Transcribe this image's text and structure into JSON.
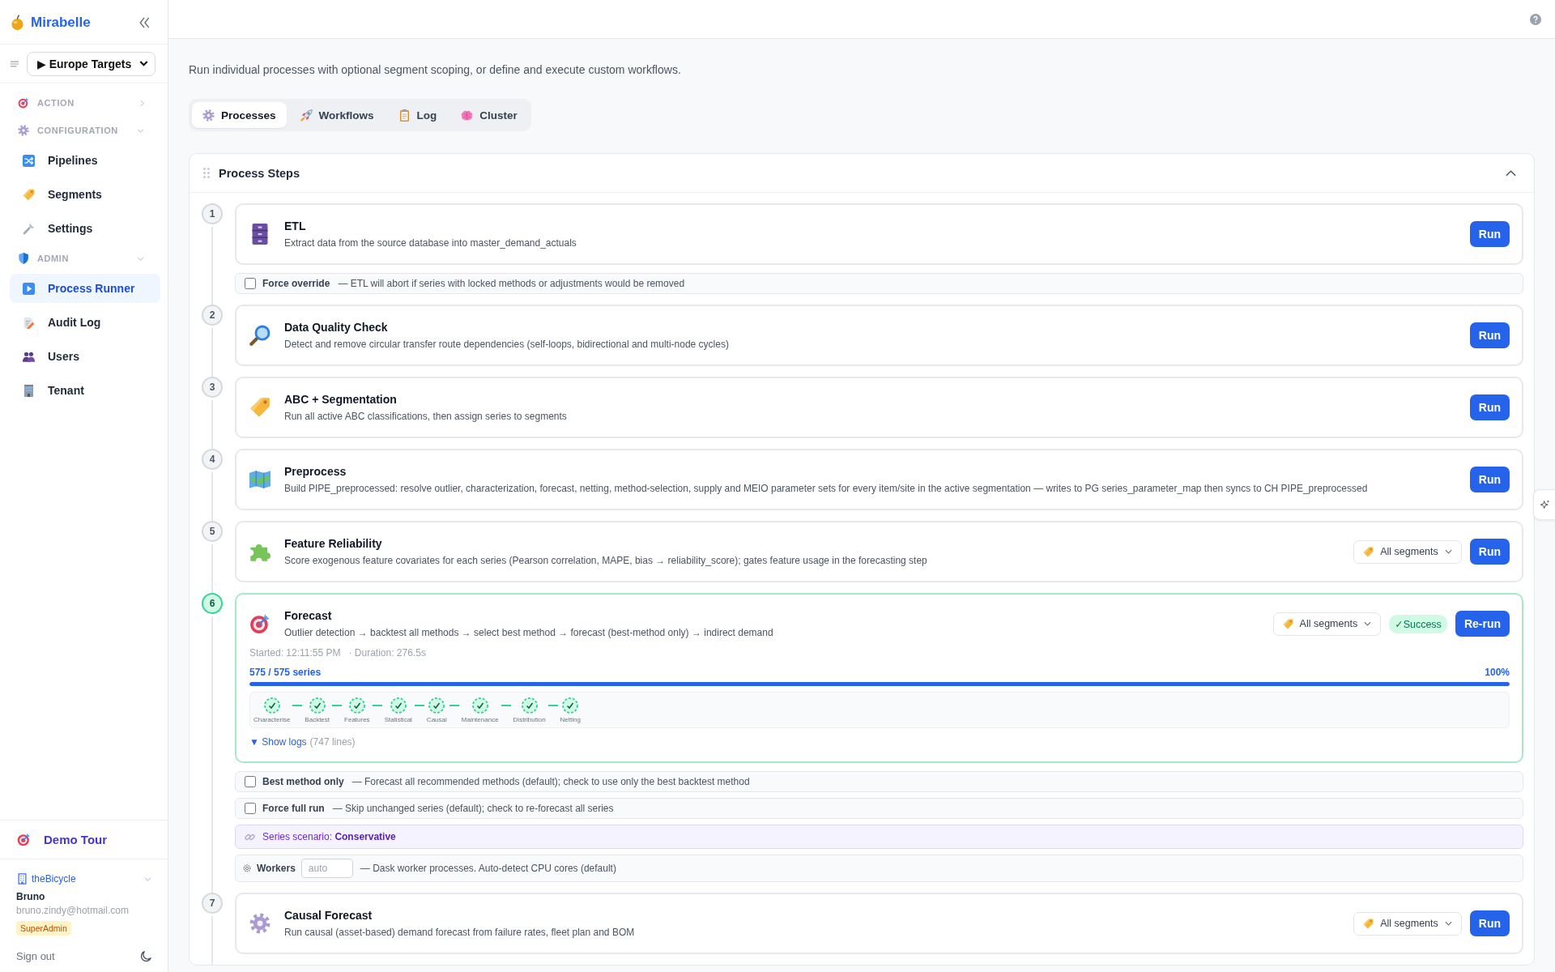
{
  "sidebar": {
    "brand": "Mirabelle",
    "selector": {
      "value": "▶ Europe Targets"
    },
    "sections": [
      {
        "label": "ACTION",
        "expanded": false
      },
      {
        "label": "CONFIGURATION",
        "expanded": true,
        "items": [
          {
            "label": "Pipelines",
            "selected": false
          },
          {
            "label": "Segments",
            "selected": false
          },
          {
            "label": "Settings",
            "selected": false
          }
        ]
      },
      {
        "label": "ADMIN",
        "expanded": true,
        "items": [
          {
            "label": "Process Runner",
            "selected": true
          },
          {
            "label": "Audit Log",
            "selected": false
          },
          {
            "label": "Users",
            "selected": false
          },
          {
            "label": "Tenant",
            "selected": false
          }
        ]
      }
    ],
    "demo_tour": "Demo Tour",
    "tenant": "theBicycle",
    "user": {
      "name": "Bruno",
      "email": "bruno.zindy@hotmail.com",
      "role": "SuperAdmin"
    },
    "sign_out": "Sign out"
  },
  "description": "Run individual processes with optional segment scoping, or define and execute custom workflows.",
  "tabs": [
    {
      "label": "Processes",
      "selected": true
    },
    {
      "label": "Workflows",
      "selected": false
    },
    {
      "label": "Log",
      "selected": false
    },
    {
      "label": "Cluster",
      "selected": false
    }
  ],
  "panel": {
    "title": "Process Steps",
    "expanded": true,
    "steps": [
      {
        "number": "1",
        "title": "ETL",
        "description": "Extract data from the source database into master_demand_actuals",
        "succeeded": false,
        "button": "Run",
        "options": [
          {
            "kind": "checkbox",
            "label": "Force override",
            "checked": false,
            "note": "— ETL will abort if series with locked methods or adjustments would be removed"
          }
        ]
      },
      {
        "number": "2",
        "title": "Data Quality Check",
        "description": "Detect and remove circular transfer route dependencies (self-loops, bidirectional and multi-node cycles)",
        "succeeded": false,
        "button": "Run"
      },
      {
        "number": "3",
        "title": "ABC + Segmentation",
        "description": "Run all active ABC classifications, then assign series to segments",
        "succeeded": false,
        "button": "Run"
      },
      {
        "number": "4",
        "title": "Preprocess",
        "description": "Build PIPE_preprocessed: resolve outlier, characterization, forecast, netting, method-selection, supply and MEIO parameter sets for every item/site in the active segmentation — writes to PG series_parameter_map then syncs to CH PIPE_preprocessed",
        "succeeded": false,
        "button": "Run"
      },
      {
        "number": "5",
        "title": "Feature Reliability",
        "description": "Score exogenous feature covariates for each series (Pearson correlation, MAPE, bias → reliability_score); gates feature usage in the forecasting step",
        "succeeded": false,
        "segment": "All segments",
        "button": "Run"
      },
      {
        "number": "6",
        "title": "Forecast",
        "description": "Outlier detection → backtest all methods → select best method → forecast (best-method only) → indirect demand",
        "succeeded": true,
        "segment": "All segments",
        "badge": "✓Success",
        "button": "Re-run",
        "started": "Started: 12:11:55 PM",
        "duration": "· Duration: 276.5s",
        "progress": {
          "count": "575 / 575 series",
          "percent": "100%",
          "level": 1
        },
        "stages": [
          {
            "label": "Characterise",
            "done": true
          },
          {
            "label": "Backtest",
            "done": true
          },
          {
            "label": "Features",
            "done": true
          },
          {
            "label": "Statistical",
            "done": true
          },
          {
            "label": "Causal",
            "done": true
          },
          {
            "label": "Maintenance",
            "done": true
          },
          {
            "label": "Distribution",
            "done": true
          },
          {
            "label": "Netting",
            "done": true
          }
        ],
        "logs": {
          "link": "▼ Show logs",
          "count": "(747 lines)"
        },
        "options": [
          {
            "kind": "checkbox",
            "label": "Best method only",
            "checked": false,
            "note": "— Forecast all recommended methods (default); check to use only the best backtest method"
          },
          {
            "kind": "checkbox",
            "label": "Force full run",
            "checked": false,
            "note": "— Skip unchanged series (default); check to re-forecast all series"
          },
          {
            "kind": "scenario",
            "text": "Series scenario: **Conservative**"
          },
          {
            "kind": "workers",
            "label": "Workers",
            "placeholder": "auto",
            "note": "— Dask worker processes. Auto-detect CPU cores (default)"
          }
        ]
      },
      {
        "number": "7",
        "title": "Causal Forecast",
        "description": "Run causal (asset-based) demand forecast from failure rates, fleet plan and BOM",
        "succeeded": false,
        "segment": "All segments",
        "button": "Run"
      }
    ]
  }
}
